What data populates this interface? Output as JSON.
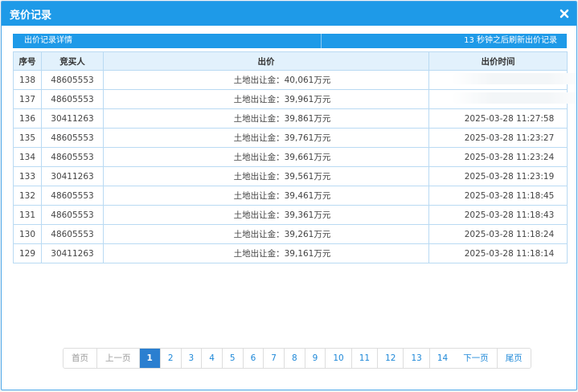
{
  "dialog": {
    "title": "竞价记录",
    "close_icon": "close-icon"
  },
  "infobar": {
    "left": "出价记录详情",
    "right": "13 秒钟之后刷新出价记录"
  },
  "table": {
    "headers": [
      "序号",
      "竞买人",
      "出价",
      "出价时间"
    ],
    "rows": [
      {
        "seq": "138",
        "bidder": "48605553",
        "price": "土地出让金：40,061万元",
        "time": ""
      },
      {
        "seq": "137",
        "bidder": "48605553",
        "price": "土地出让金：39,961万元",
        "time": ""
      },
      {
        "seq": "136",
        "bidder": "30411263",
        "price": "土地出让金：39,861万元",
        "time": "2025-03-28 11:27:58"
      },
      {
        "seq": "135",
        "bidder": "48605553",
        "price": "土地出让金：39,761万元",
        "time": "2025-03-28 11:23:27"
      },
      {
        "seq": "134",
        "bidder": "48605553",
        "price": "土地出让金：39,661万元",
        "time": "2025-03-28 11:23:24"
      },
      {
        "seq": "133",
        "bidder": "30411263",
        "price": "土地出让金：39,561万元",
        "time": "2025-03-28 11:23:19"
      },
      {
        "seq": "132",
        "bidder": "48605553",
        "price": "土地出让金：39,461万元",
        "time": "2025-03-28 11:18:45"
      },
      {
        "seq": "131",
        "bidder": "48605553",
        "price": "土地出让金：39,361万元",
        "time": "2025-03-28 11:18:43"
      },
      {
        "seq": "130",
        "bidder": "48605553",
        "price": "土地出让金：39,261万元",
        "time": "2025-03-28 11:18:24"
      },
      {
        "seq": "129",
        "bidder": "30411263",
        "price": "土地出让金：39,161万元",
        "time": "2025-03-28 11:18:14"
      }
    ]
  },
  "pager": {
    "first": "首页",
    "prev": "上一页",
    "pages": [
      "1",
      "2",
      "3",
      "4",
      "5",
      "6",
      "7",
      "8",
      "9",
      "10",
      "11",
      "12",
      "13",
      "14"
    ],
    "active": "1",
    "next": "下一页",
    "last": "尾页"
  },
  "colors": {
    "accent": "#1e9ae8",
    "active_page": "#2b7fd0",
    "header_bg": "#e2f1fc"
  }
}
